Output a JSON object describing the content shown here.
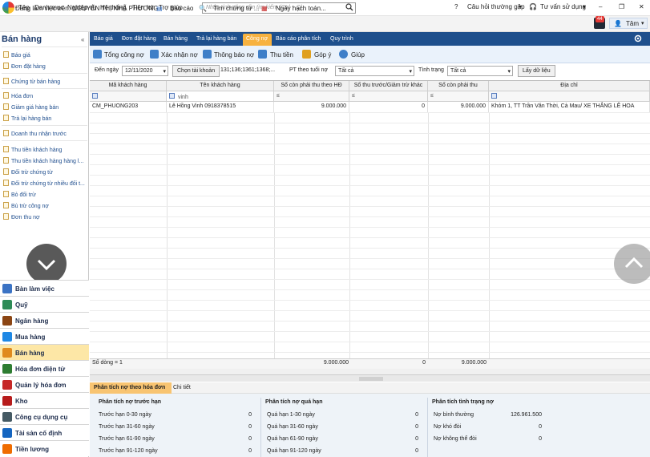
{
  "menubar": {
    "items": [
      "Tệp",
      "Danh mục",
      "Nghiệp vụ",
      "Hệ thống",
      "Tiện ích",
      "Trợ giúp"
    ],
    "search_placeholder": "Nhập tính năng cần tìm kiếm (Ctrl + Q)",
    "faq": "Câu hỏi thường gặp",
    "support": "Tư vấn sử dụng"
  },
  "toolbar2": {
    "working_on": "Đang làm việc trên: NGUYỄN THỊ NHÃ PHƯƠNG",
    "report": "Báo cáo",
    "find_voucher": "Tìm chứng từ ...",
    "accounting_date": "Ngày hạch toán...",
    "notif_count": "44",
    "user": "Tâm"
  },
  "sidebar": {
    "title": "Bán hàng",
    "links": [
      "Báo giá",
      "Đơn đặt hàng",
      "Chứng từ bán hàng",
      "Hóa đơn",
      "Giảm giá hàng bán",
      "Trả lại hàng bán",
      "Doanh thu nhận trước",
      "Thu tiền khách hàng",
      "Thu tiền khách hàng hàng l...",
      "Đối trừ chứng từ",
      "Đối trừ chứng từ nhiều đối t...",
      "Bỏ đối trừ",
      "Bù trừ công nợ",
      "Đơn thu nợ"
    ],
    "modules": [
      {
        "label": "Bàn làm việc",
        "color": "#3b73c4"
      },
      {
        "label": "Quỹ",
        "color": "#2e8b57"
      },
      {
        "label": "Ngân hàng",
        "color": "#8b4513"
      },
      {
        "label": "Mua hàng",
        "color": "#1e88e5"
      },
      {
        "label": "Bán hàng",
        "color": "#e08a1e"
      },
      {
        "label": "Hóa đơn điện tử",
        "color": "#2e7d32"
      },
      {
        "label": "Quản lý hóa đơn",
        "color": "#c62828"
      },
      {
        "label": "Kho",
        "color": "#b71c1c"
      },
      {
        "label": "Công cụ dụng cụ",
        "color": "#455a64"
      },
      {
        "label": "Tài sản cố định",
        "color": "#1565c0"
      },
      {
        "label": "Tiền lương",
        "color": "#ef6c00"
      }
    ]
  },
  "tabs": [
    "Báo giá",
    "Đơn đặt hàng",
    "Bán hàng",
    "Trả lại hàng bán",
    "Công nợ",
    "Báo cáo phân tích",
    "Quy trình"
  ],
  "actions": [
    "Tổng công nợ",
    "Xác nhận nợ",
    "Thông báo nợ",
    "Thu tiền",
    "Góp ý",
    "Giúp"
  ],
  "filters": {
    "date_label": "Đến ngày",
    "date_value": "12/11/2020",
    "choose_account": "Chọn tài khoản",
    "accounts": "131;136;1361;1368;...",
    "aging_label": "PT theo tuổi nợ",
    "aging_value": "Tất cả",
    "status_label": "Tình trạng",
    "status_value": "Tất cả",
    "load_button": "Lấy dữ liệu"
  },
  "grid": {
    "columns": [
      "Mã khách hàng",
      "Tên khách hàng",
      "Số còn phải thu theo HĐ",
      "Số thu trước/Giảm trừ khác",
      "Số còn phải thu",
      "Địa chỉ"
    ],
    "filter_values": [
      "",
      "vinh",
      "≤",
      "≤",
      "≤",
      ""
    ],
    "rows": [
      [
        "CM_PHUONG203",
        "Lê Hồng Vinh 0918378515",
        "9.000.000",
        "0",
        "9.000.000",
        "Khóm 1, TT  Trần Văn Thời, Cà Mau/ XE THẮNG LÊ HOA"
      ]
    ],
    "footer_count": "Số dòng = 1",
    "footer_total1": "9.000.000",
    "footer_total2": "0",
    "footer_total3": "9.000.000"
  },
  "bottom": {
    "tabs": [
      "Phân tích nợ theo hóa đơn",
      "Chi tiết"
    ],
    "sections": [
      {
        "title": "Phân tích nợ trước hạn",
        "rows": [
          [
            "Trước hạn 0-30 ngày",
            "0"
          ],
          [
            "Trước hạn 31-60 ngày",
            "0"
          ],
          [
            "Trước hạn 61-90 ngày",
            "0"
          ],
          [
            "Trước hạn 91-120 ngày",
            "0"
          ]
        ]
      },
      {
        "title": "Phân tích nợ quá hạn",
        "rows": [
          [
            "Quá hạn 1-30 ngày",
            "0"
          ],
          [
            "Quá hạn 31-60 ngày",
            "0"
          ],
          [
            "Quá hạn 61-90 ngày",
            "0"
          ],
          [
            "Quá hạn 91-120 ngày",
            "0"
          ]
        ]
      },
      {
        "title": "Phân tích tình trạng nợ",
        "rows": [
          [
            "Nợ bình thường",
            "126.961.500"
          ],
          [
            "Nợ khó đòi",
            "0"
          ],
          [
            "Nợ không thể đòi",
            "0"
          ]
        ]
      }
    ]
  }
}
